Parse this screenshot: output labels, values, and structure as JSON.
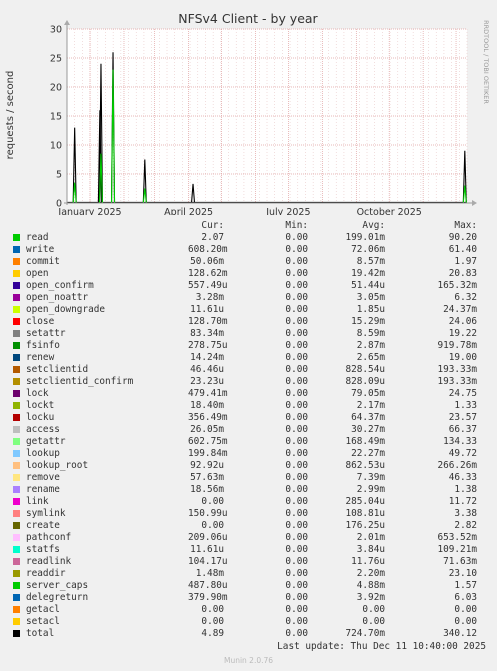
{
  "chart_data": {
    "type": "line",
    "title": "NFSv4 Client - by year",
    "ylabel": "requests / second",
    "ylim": [
      0,
      30
    ],
    "yticks": [
      0,
      5,
      10,
      15,
      20,
      25,
      30
    ],
    "xtick_labels": [
      "January 2025",
      "April 2025",
      "July 2025",
      "October 2025"
    ],
    "grid": true,
    "side_text": "RRDTOOL / TOBI OETIKER",
    "total_peaks": [
      {
        "date": "2024-12-18",
        "value": 13
      },
      {
        "date": "2025-01-10",
        "value": 16
      },
      {
        "date": "2025-01-11",
        "value": 24
      },
      {
        "date": "2025-01-22",
        "value": 26
      },
      {
        "date": "2025-02-20",
        "value": 7.5
      },
      {
        "date": "2025-04-05",
        "value": 3.3
      },
      {
        "date": "2025-12-09",
        "value": 9
      }
    ],
    "read_peaks": [
      {
        "date": "2024-12-18",
        "value": 3.5
      },
      {
        "date": "2025-01-11",
        "value": 8.5
      },
      {
        "date": "2025-01-22",
        "value": 23
      },
      {
        "date": "2025-02-20",
        "value": 2.5
      },
      {
        "date": "2025-12-09",
        "value": 3
      }
    ]
  },
  "legend": {
    "headers": [
      "Cur:",
      "Min:",
      "Avg:",
      "Max:"
    ],
    "rows": [
      {
        "name": "read",
        "color": "#00cc00",
        "cur": "2.07",
        "min": "0.00",
        "avg": "199.01m",
        "max": "90.20"
      },
      {
        "name": "write",
        "color": "#0066b3",
        "cur": "608.20m",
        "min": "0.00",
        "avg": "72.06m",
        "max": "61.40"
      },
      {
        "name": "commit",
        "color": "#ff8000",
        "cur": "50.06m",
        "min": "0.00",
        "avg": "8.57m",
        "max": "1.97"
      },
      {
        "name": "open",
        "color": "#ffcc00",
        "cur": "128.62m",
        "min": "0.00",
        "avg": "19.42m",
        "max": "20.83"
      },
      {
        "name": "open_confirm",
        "color": "#330099",
        "cur": "557.49u",
        "min": "0.00",
        "avg": "51.44u",
        "max": "165.32m"
      },
      {
        "name": "open_noattr",
        "color": "#990099",
        "cur": "3.28m",
        "min": "0.00",
        "avg": "3.05m",
        "max": "6.32"
      },
      {
        "name": "open_downgrade",
        "color": "#ccff00",
        "cur": "11.61u",
        "min": "0.00",
        "avg": "1.85u",
        "max": "24.37m"
      },
      {
        "name": "close",
        "color": "#ff0000",
        "cur": "128.70m",
        "min": "0.00",
        "avg": "15.29m",
        "max": "24.06"
      },
      {
        "name": "setattr",
        "color": "#808080",
        "cur": "83.34m",
        "min": "0.00",
        "avg": "8.59m",
        "max": "19.22"
      },
      {
        "name": "fsinfo",
        "color": "#008f00",
        "cur": "278.75u",
        "min": "0.00",
        "avg": "2.87m",
        "max": "919.78m"
      },
      {
        "name": "renew",
        "color": "#00487d",
        "cur": "14.24m",
        "min": "0.00",
        "avg": "2.65m",
        "max": "19.00"
      },
      {
        "name": "setclientid",
        "color": "#b35a00",
        "cur": "46.46u",
        "min": "0.00",
        "avg": "828.54u",
        "max": "193.33m"
      },
      {
        "name": "setclientid_confirm",
        "color": "#b38f00",
        "cur": "23.23u",
        "min": "0.00",
        "avg": "828.09u",
        "max": "193.33m"
      },
      {
        "name": "lock",
        "color": "#6b006b",
        "cur": "479.41m",
        "min": "0.00",
        "avg": "79.05m",
        "max": "24.75"
      },
      {
        "name": "lockt",
        "color": "#8fb300",
        "cur": "18.40m",
        "min": "0.00",
        "avg": "2.17m",
        "max": "1.33"
      },
      {
        "name": "locku",
        "color": "#b30000",
        "cur": "356.49m",
        "min": "0.00",
        "avg": "64.37m",
        "max": "23.57"
      },
      {
        "name": "access",
        "color": "#bebebe",
        "cur": "26.05m",
        "min": "0.00",
        "avg": "30.27m",
        "max": "66.37"
      },
      {
        "name": "getattr",
        "color": "#80ff80",
        "cur": "602.75m",
        "min": "0.00",
        "avg": "168.49m",
        "max": "134.33"
      },
      {
        "name": "lookup",
        "color": "#80c9ff",
        "cur": "199.84m",
        "min": "0.00",
        "avg": "22.27m",
        "max": "49.72"
      },
      {
        "name": "lookup_root",
        "color": "#ffc080",
        "cur": "92.92u",
        "min": "0.00",
        "avg": "862.53u",
        "max": "266.26m"
      },
      {
        "name": "remove",
        "color": "#ffe680",
        "cur": "57.63m",
        "min": "0.00",
        "avg": "7.39m",
        "max": "46.33"
      },
      {
        "name": "rename",
        "color": "#aa80ff",
        "cur": "18.56m",
        "min": "0.00",
        "avg": "2.99m",
        "max": "1.38"
      },
      {
        "name": "link",
        "color": "#ee00cc",
        "cur": "0.00",
        "min": "0.00",
        "avg": "285.04u",
        "max": "11.72"
      },
      {
        "name": "symlink",
        "color": "#ff8080",
        "cur": "150.99u",
        "min": "0.00",
        "avg": "108.81u",
        "max": "3.38"
      },
      {
        "name": "create",
        "color": "#666600",
        "cur": "0.00",
        "min": "0.00",
        "avg": "176.25u",
        "max": "2.82"
      },
      {
        "name": "pathconf",
        "color": "#ffbfff",
        "cur": "209.06u",
        "min": "0.00",
        "avg": "2.01m",
        "max": "653.52m"
      },
      {
        "name": "statfs",
        "color": "#00ffcc",
        "cur": "11.61u",
        "min": "0.00",
        "avg": "3.84u",
        "max": "109.21m"
      },
      {
        "name": "readlink",
        "color": "#cc6699",
        "cur": "104.17u",
        "min": "0.00",
        "avg": "11.76u",
        "max": "71.63m"
      },
      {
        "name": "readdir",
        "color": "#999900",
        "cur": "1.48m",
        "min": "0.00",
        "avg": "2.20m",
        "max": "23.10"
      },
      {
        "name": "server_caps",
        "color": "#00cc00",
        "cur": "487.80u",
        "min": "0.00",
        "avg": "4.88m",
        "max": "1.57"
      },
      {
        "name": "delegreturn",
        "color": "#0066b3",
        "cur": "379.90m",
        "min": "0.00",
        "avg": "3.92m",
        "max": "6.03"
      },
      {
        "name": "getacl",
        "color": "#ff8000",
        "cur": "0.00",
        "min": "0.00",
        "avg": "0.00",
        "max": "0.00"
      },
      {
        "name": "setacl",
        "color": "#ffcc00",
        "cur": "0.00",
        "min": "0.00",
        "avg": "0.00",
        "max": "0.00"
      },
      {
        "name": "total",
        "color": "#000000",
        "cur": "4.89",
        "min": "0.00",
        "avg": "724.70m",
        "max": "340.12"
      }
    ]
  },
  "footer": {
    "last_update": "Last update: Thu Dec 11 10:40:00 2025",
    "munin": "Munin 2.0.76"
  }
}
